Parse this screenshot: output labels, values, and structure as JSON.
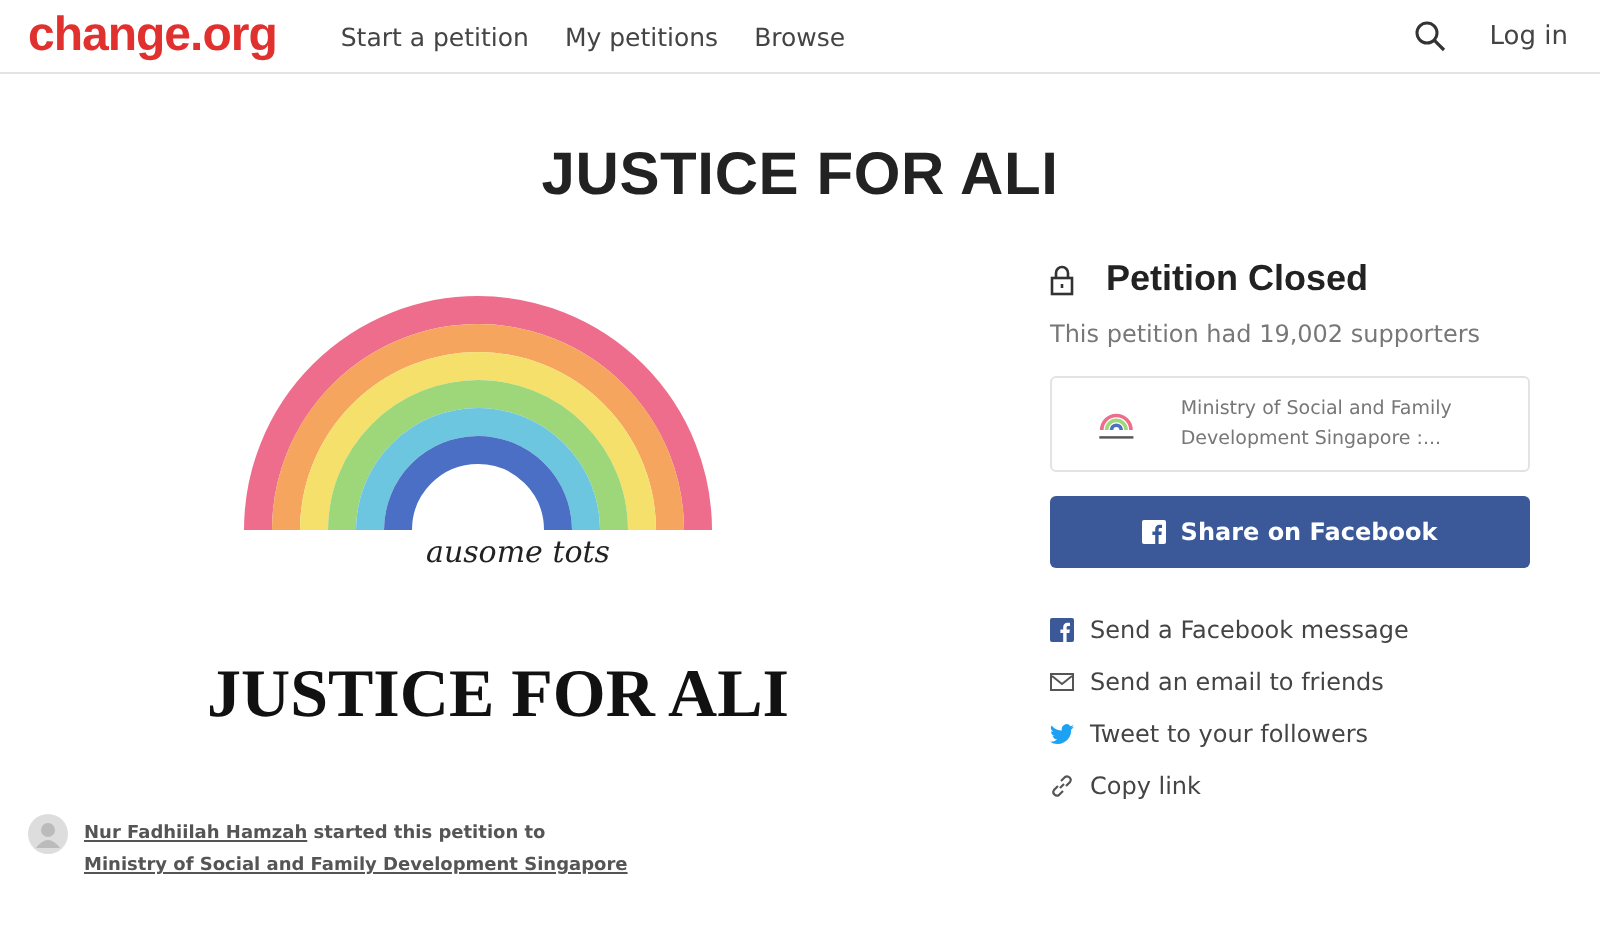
{
  "header": {
    "logo": "change.org",
    "nav": [
      {
        "label": "Start a petition"
      },
      {
        "label": "My petitions"
      },
      {
        "label": "Browse"
      }
    ],
    "login": "Log in"
  },
  "title": "JUSTICE FOR ALI",
  "image": {
    "caption": "ausome tots",
    "headline": "JUSTICE FOR ALI"
  },
  "starter": {
    "name": "Nur Fadhiilah Hamzah",
    "text": " started this petition to ",
    "target": "Ministry of Social and Family Development Singapore"
  },
  "status": {
    "heading": "Petition Closed",
    "supporters": "This petition had 19,002 supporters"
  },
  "preview": {
    "text": "Ministry of Social and Family Development Singapore :..."
  },
  "share_button": "Share on Facebook",
  "share_links": [
    {
      "kind": "facebook",
      "label": "Send a Facebook message"
    },
    {
      "kind": "email",
      "label": "Send an email to friends"
    },
    {
      "kind": "twitter",
      "label": "Tweet to your followers"
    },
    {
      "kind": "link",
      "label": "Copy link"
    }
  ]
}
